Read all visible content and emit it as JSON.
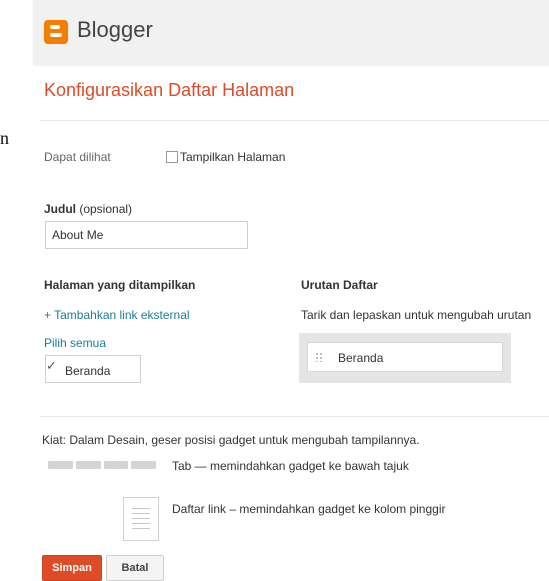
{
  "brand": {
    "name": "Blogger",
    "logo_icon": "blogger-logo-icon",
    "accent": "#f57d00"
  },
  "page_title": "Konfigurasikan Daftar Halaman",
  "visibility": {
    "label": "Dapat dilihat",
    "checkbox_label": "Tampilkan Halaman",
    "checked": false
  },
  "title_field": {
    "label_bold": "Judul",
    "label_rest": " (opsional)",
    "value": "About Me"
  },
  "pages_section": {
    "heading": "Halaman yang ditampilkan",
    "add_external_link": "+ Tambahkan link eksternal",
    "select_all": "Pilih semua",
    "items": [
      {
        "label": "Beranda",
        "checked": true
      }
    ]
  },
  "order_section": {
    "heading": "Urutan Daftar",
    "hint": "Tarik dan lepaskan untuk mengubah urutan",
    "items": [
      {
        "label": "Beranda"
      }
    ]
  },
  "tip": {
    "text": "Kiat: Dalam Desain, geser posisi gadget untuk mengubah tampilannya.",
    "tab_description": "Tab — memindahkan gadget ke bawah tajuk",
    "list_description": "Daftar link – memindahkan gadget ke kolom pinggir"
  },
  "buttons": {
    "save": "Simpan",
    "cancel": "Batal"
  },
  "colors": {
    "accent": "#dd4b27",
    "link": "#1b7e99"
  }
}
